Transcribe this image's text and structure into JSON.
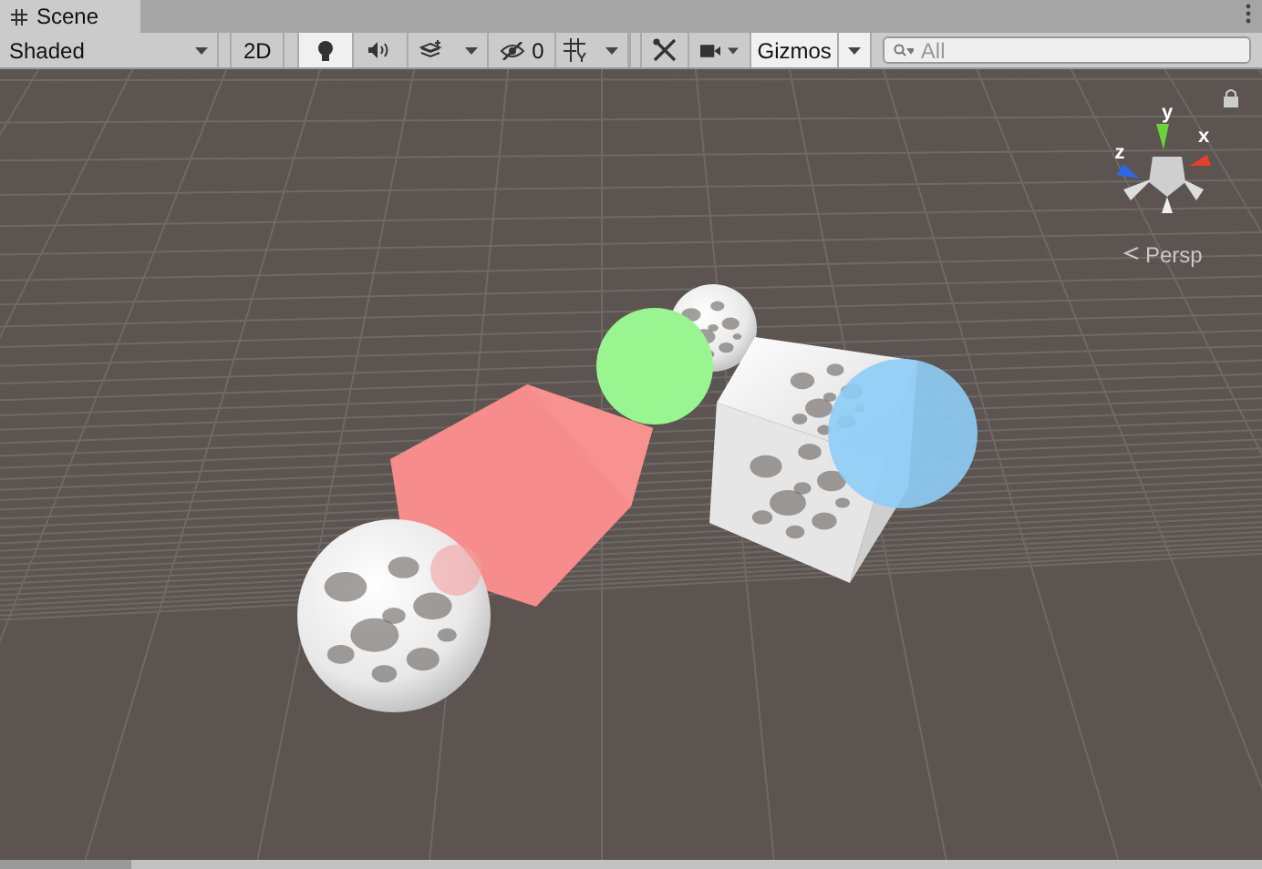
{
  "tab": {
    "label": "Scene",
    "selected": true
  },
  "toolbar": {
    "draw_mode": "Shaded",
    "two_d": {
      "label": "2D",
      "selected": false
    },
    "lighting": {
      "selected": true
    },
    "audio": {
      "selected": false
    },
    "effects": {
      "selected": false
    },
    "hidden": {
      "count": "0",
      "selected": false
    },
    "grid": {
      "selected": false
    },
    "gizmos": {
      "label": "Gizmos",
      "selected": true
    },
    "search": {
      "placeholder": "All"
    }
  },
  "orientation_gizmo": {
    "x_label": "x",
    "y_label": "y",
    "z_label": "z",
    "projection": "Persp"
  }
}
